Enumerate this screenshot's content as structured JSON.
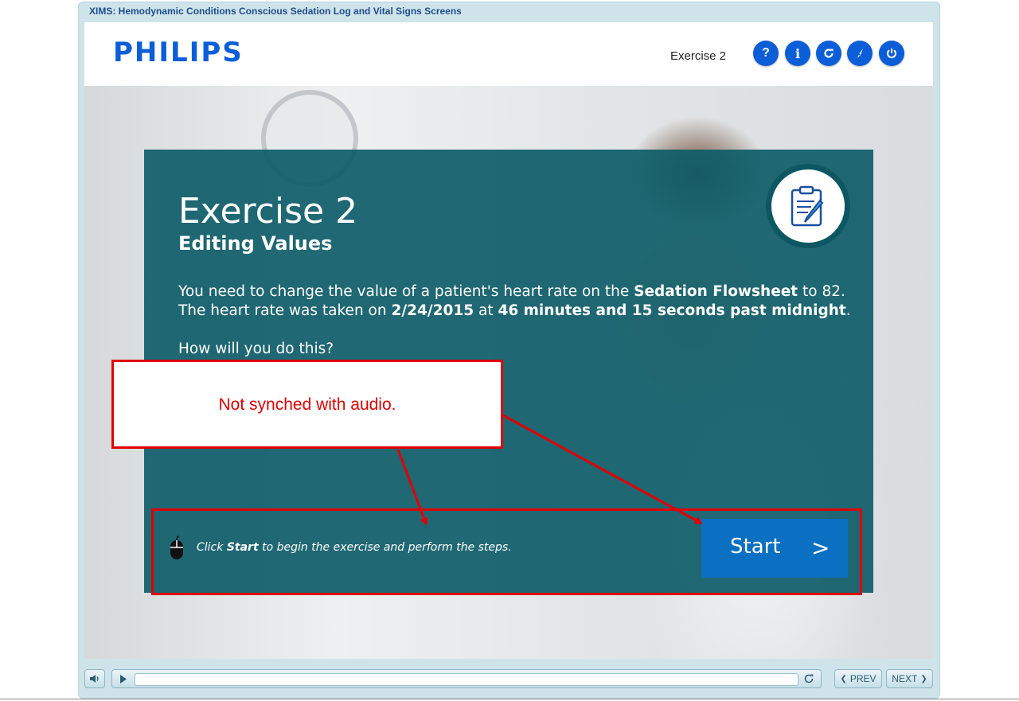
{
  "window": {
    "title": "XIMS: Hemodynamic Conditions Conscious Sedation Log and Vital Signs Screens"
  },
  "header": {
    "logo": "PHILIPS",
    "exercise_label": "Exercise 2",
    "buttons": [
      {
        "name": "help",
        "icon": "question-icon",
        "glyph": "?"
      },
      {
        "name": "info",
        "icon": "info-icon",
        "glyph": "i"
      },
      {
        "name": "replay",
        "icon": "refresh-icon"
      },
      {
        "name": "glossary",
        "icon": "compass-icon"
      },
      {
        "name": "exit",
        "icon": "power-icon"
      }
    ],
    "accent_color": "#0b5ed7"
  },
  "exercise": {
    "title": "Exercise 2",
    "subtitle": "Editing Values",
    "para_part1": "You need to change the value of a patient's heart rate on the ",
    "para_bold1": "Sedation Flowsheet",
    "para_part2": " to 82. The heart rate was taken on ",
    "para_bold2": "2/24/2015",
    "para_part3": " at ",
    "para_bold3": "46 minutes and 15 seconds past midnight",
    "para_part4": ".",
    "question": "How will you do this?",
    "badge_icon": "clipboard-pencil-icon",
    "panel_color": "#0e5c68"
  },
  "instruction": {
    "icon": "mouse-icon",
    "prefix": "Click ",
    "bold": "Start",
    "suffix": " to begin the exercise and perform the steps."
  },
  "start_button": {
    "label": "Start",
    "chevron": ">"
  },
  "annotation": {
    "note": "Not synched with audio.",
    "color": "#e00000"
  },
  "controls": {
    "audio_icon": "speaker-icon",
    "play_icon": "play-icon",
    "replay_icon": "replay-icon",
    "prev_label": "PREV",
    "next_label": "NEXT"
  }
}
